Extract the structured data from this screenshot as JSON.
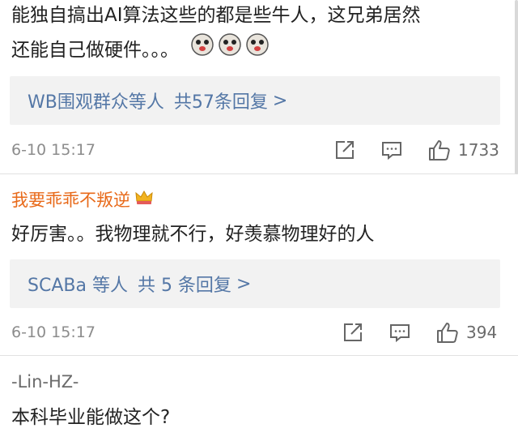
{
  "comments": [
    {
      "text_line1": "能独自搞出AI算法这些的都是些牛人，这兄弟居然",
      "text_line2": "还能自己做硬件。。。",
      "emoji_icons": [
        "doge-emoji",
        "doge-emoji",
        "doge-emoji"
      ],
      "replies": {
        "names": "WB围观群众等人",
        "count": "共57条回复",
        "chevron": ">"
      },
      "time": "6-10 15:17",
      "likes": "1733"
    },
    {
      "user": "我要乖乖不叛逆",
      "badge_icon": "crown-badge-icon",
      "text": "好厉害。。我物理就不行，好羡慕物理好的人",
      "replies": {
        "names": "SCABa 等人",
        "count": "共 5 条回复",
        "chevron": ">"
      },
      "time": "6-10 15:17",
      "likes": "394"
    },
    {
      "user": "-Lin-HZ-",
      "text": "本科毕业能做这个?"
    }
  ],
  "icons": {
    "share": "share-icon",
    "comment": "comment-icon",
    "like": "thumbs-up-icon"
  },
  "colors": {
    "username": "#e86a1a",
    "reply_link": "#5477a6",
    "reply_bg": "#f2f2f2",
    "meta": "#8c8c8c"
  }
}
